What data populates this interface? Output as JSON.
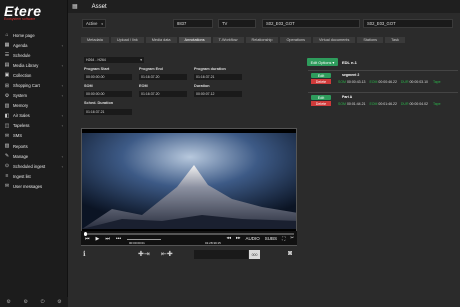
{
  "sidebar": {
    "logo": "Etere",
    "logo_sub": "Ecosystem software",
    "items": [
      {
        "label": "Home page",
        "icon": "home-icon",
        "glyph": "⌂",
        "arrow": ""
      },
      {
        "label": "Agenda",
        "icon": "calendar-icon",
        "glyph": "▦",
        "arrow": "‹"
      },
      {
        "label": "Schedule",
        "icon": "schedule-icon",
        "glyph": "☰",
        "arrow": ""
      },
      {
        "label": "Media Library",
        "icon": "film-icon",
        "glyph": "▤",
        "arrow": "‹"
      },
      {
        "label": "Collection",
        "icon": "collection-icon",
        "glyph": "▣",
        "arrow": ""
      },
      {
        "label": "Shopping Cart",
        "icon": "cart-icon",
        "glyph": "⊞",
        "arrow": "‹"
      },
      {
        "label": "System",
        "icon": "gear-icon",
        "glyph": "⚙",
        "arrow": "‹"
      },
      {
        "label": "Memory",
        "icon": "memory-icon",
        "glyph": "▥",
        "arrow": ""
      },
      {
        "label": "Air Sales",
        "icon": "sales-icon",
        "glyph": "◧",
        "arrow": "‹"
      },
      {
        "label": "Tapeless",
        "icon": "tape-icon",
        "glyph": "◫",
        "arrow": "‹"
      },
      {
        "label": "SMS",
        "icon": "sms-icon",
        "glyph": "✉",
        "arrow": ""
      },
      {
        "label": "Reports",
        "icon": "report-icon",
        "glyph": "▨",
        "arrow": ""
      },
      {
        "label": "Manage",
        "icon": "manage-icon",
        "glyph": "✎",
        "arrow": "‹"
      },
      {
        "label": "Scheduled ingest",
        "icon": "ingest-icon",
        "glyph": "⊙",
        "arrow": "‹"
      },
      {
        "label": "Ingest list",
        "icon": "list-icon",
        "glyph": "≡",
        "arrow": ""
      },
      {
        "label": "User messages",
        "icon": "message-icon",
        "glyph": "✉",
        "arrow": ""
      }
    ],
    "footer_icons": [
      "⚙",
      "⚙",
      "⏻",
      "⚙"
    ]
  },
  "topbar": {
    "title": "Asset"
  },
  "asset": {
    "status": "Active",
    "code": "8837",
    "type": "TV",
    "id1": "S02_E03_GOT",
    "id2": "S02_E03_GOT"
  },
  "tabs": [
    "Metadata",
    "Upload / link",
    "Media data",
    "Annotations",
    "T-Workflow",
    "Relationship",
    "Operations",
    "Virtual documents",
    "Stations",
    "Task"
  ],
  "active_tab": "Annotations",
  "annotations": {
    "format": "H264 - H264",
    "program_start_label": "Program Start",
    "program_start": "00:00:00.00",
    "program_end_label": "Program End",
    "program_end": "01:16:37.20",
    "program_duration_label": "Program duration",
    "program_duration": "01:16:37.21",
    "som_label": "SOM",
    "som": "00:00:00.00",
    "eom_label": "EOM",
    "eom": "01:16:37.20",
    "duration_label": "Duration",
    "duration": "00:00:07.12",
    "sched_duration_label": "Sched. Duration",
    "sched_duration": "01:16:37.21"
  },
  "player": {
    "time_current": "00:00:00:01",
    "time_total": "01:28:39:15",
    "audio": "AUDIO",
    "subs": "SUBS",
    "code_placeholder": "000"
  },
  "edl": {
    "options_label": "Edit Options ▾",
    "title": "EDL n.1",
    "segments": [
      {
        "name": "segment 2",
        "edit": "Edit",
        "delete": "Delete",
        "som_label": "SOM",
        "som": "00:00:43.13",
        "eom_label": "EOM",
        "eom": "00:00:46.22",
        "dur_label": "DUR",
        "dur": "00:00:03.10",
        "flag": "Tape"
      },
      {
        "name": "Part A",
        "edit": "Edit",
        "delete": "Delete",
        "som_label": "SOM",
        "som": "00:01:44.21",
        "eom_label": "EOM",
        "eom": "00:01:46.22",
        "dur_label": "DUR",
        "dur": "00:00:04.02",
        "flag": "Tape"
      }
    ]
  },
  "colors": {
    "accent_green": "#2e9c5c",
    "delete_red": "#cf3a3a",
    "bg": "#2b2b2b"
  }
}
